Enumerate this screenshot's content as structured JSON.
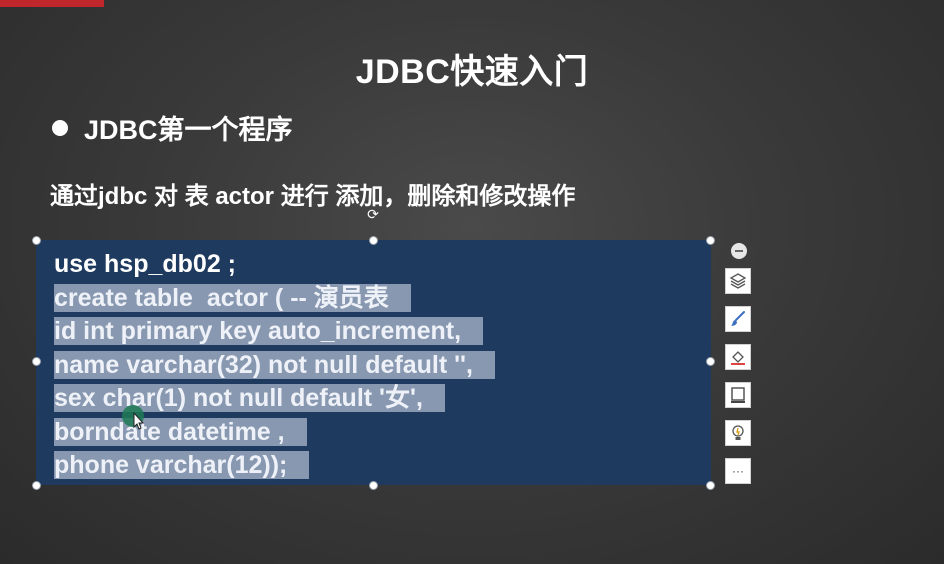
{
  "slide": {
    "title": "JDBC快速入门",
    "bullet": "JDBC第一个程序",
    "description": "通过jdbc 对 表 actor 进行 添加，删除和修改操作"
  },
  "code": {
    "lines": [
      "use hsp_db02 ;",
      "create table  actor ( -- 演员表",
      "id int primary key auto_increment,",
      "name varchar(32) not null default '',",
      "sex char(1) not null default '女',",
      "borndate datetime ,",
      "phone varchar(12));"
    ]
  },
  "toolbar": {
    "icons": [
      "collapse-icon",
      "layers-icon",
      "brush-icon",
      "fill-icon",
      "border-icon",
      "lightbulb-icon",
      "more-icon"
    ],
    "more_label": "···"
  },
  "colors": {
    "accent_red": "#c0272d",
    "textbox_bg": "#1f3a5f",
    "highlight": "#8898b0"
  }
}
